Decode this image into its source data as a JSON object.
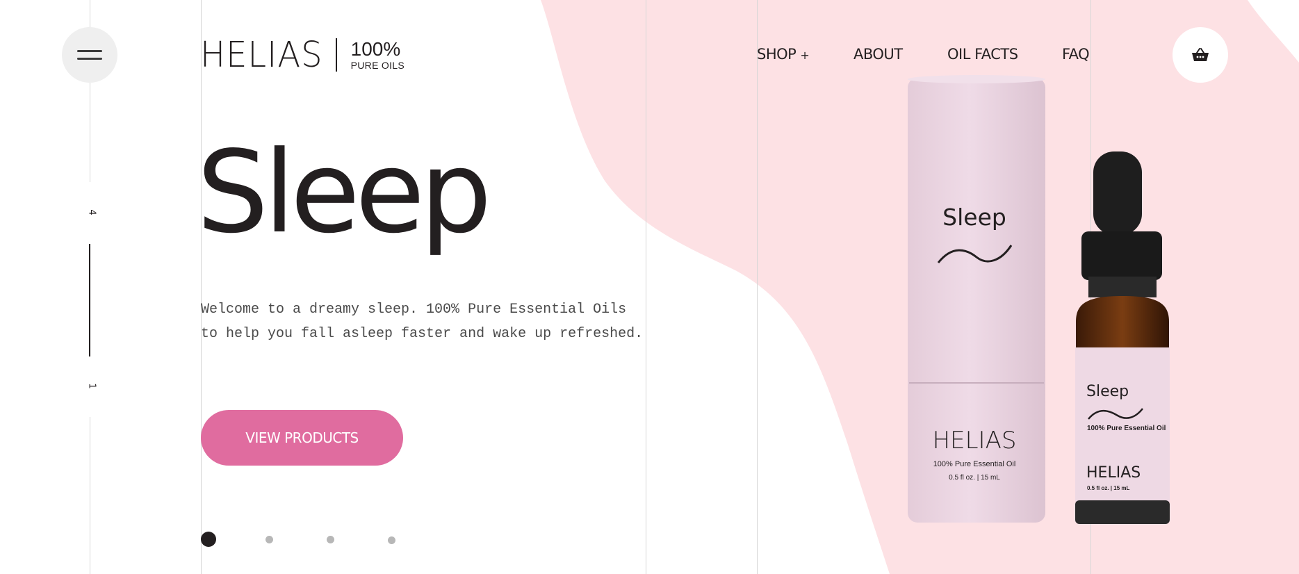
{
  "colors": {
    "accent": "#e06c9f",
    "blob": "#fde1e4",
    "text": "#231f20",
    "package": "#ecd5e2"
  },
  "header": {
    "menu_icon": "hamburger-icon",
    "logo": {
      "word": "HELIAS",
      "percent": "100%",
      "subtitle": "PURE OILS"
    },
    "nav": [
      {
        "label": "SHOP",
        "suffix": "+"
      },
      {
        "label": "ABOUT"
      },
      {
        "label": "OIL FACTS"
      },
      {
        "label": "FAQ"
      }
    ],
    "cart_icon": "basket-icon"
  },
  "slider": {
    "total": "4",
    "current": "1"
  },
  "hero": {
    "title": "Sleep",
    "description": "Welcome to a dreamy sleep. 100% Pure Essential Oils to help you fall asleep faster and wake up refreshed.",
    "cta_label": "VIEW PRODUCTS"
  },
  "pagination": {
    "count": 4,
    "active_index": 0
  },
  "product": {
    "tube": {
      "name": "Sleep",
      "brand": "HELIAS",
      "line1": "100% Pure Essential Oil",
      "line2": "0.5 fl oz.  |  15 mL"
    },
    "bottle": {
      "name": "Sleep",
      "descriptor": "100% Pure Essential Oil",
      "brand": "HELIAS",
      "size": "0.5 fl oz.  |  15 mL"
    }
  }
}
